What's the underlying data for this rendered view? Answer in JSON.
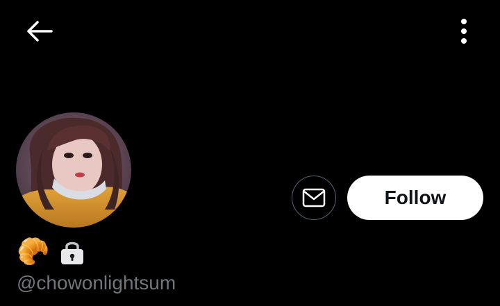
{
  "colors": {
    "background": "#000000",
    "text_primary": "#ffffff",
    "text_secondary": "#71767b",
    "border": "#536471",
    "follow_bg": "#ffffff",
    "follow_text": "#0f1419"
  },
  "header": {
    "back_icon": "arrow-left-icon",
    "more_icon": "vertical-ellipsis-icon"
  },
  "profile": {
    "avatar": "profile-photo",
    "badges": {
      "croissant": "🥐",
      "lock_icon": "lock-icon"
    },
    "handle": "@chowonlightsum"
  },
  "actions": {
    "message_icon": "envelope-icon",
    "follow_label": "Follow"
  }
}
